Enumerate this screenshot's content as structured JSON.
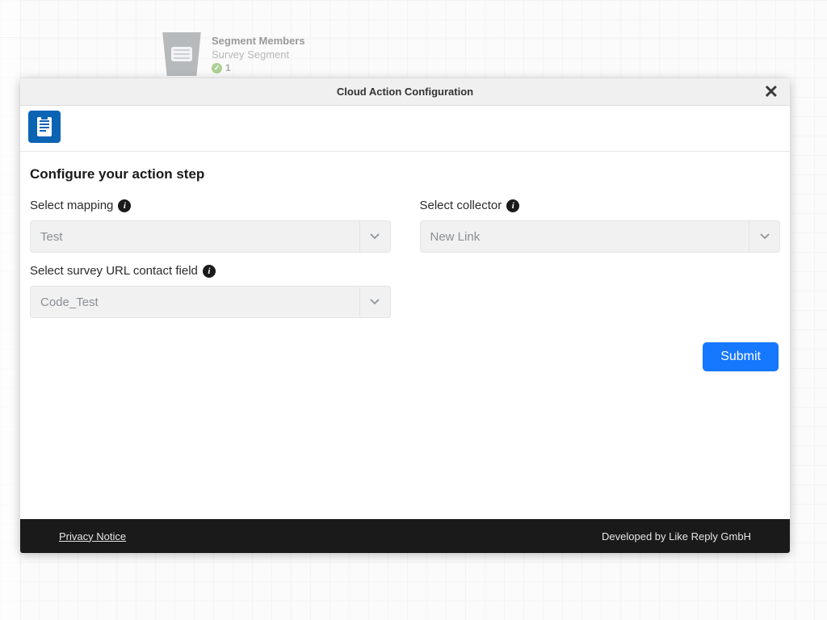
{
  "background_node": {
    "title": "Segment Members",
    "subtitle": "Survey Segment",
    "count": "1"
  },
  "modal": {
    "title": "Cloud Action Configuration",
    "section_title": "Configure your action step",
    "fields": {
      "mapping": {
        "label": "Select mapping",
        "value": "Test"
      },
      "collector": {
        "label": "Select collector",
        "value": "New Link"
      },
      "url_field": {
        "label": "Select survey URL contact field",
        "value": "Code_Test"
      }
    },
    "submit_label": "Submit",
    "footer": {
      "privacy": "Privacy Notice",
      "developer": "Developed by Like Reply GmbH"
    }
  }
}
